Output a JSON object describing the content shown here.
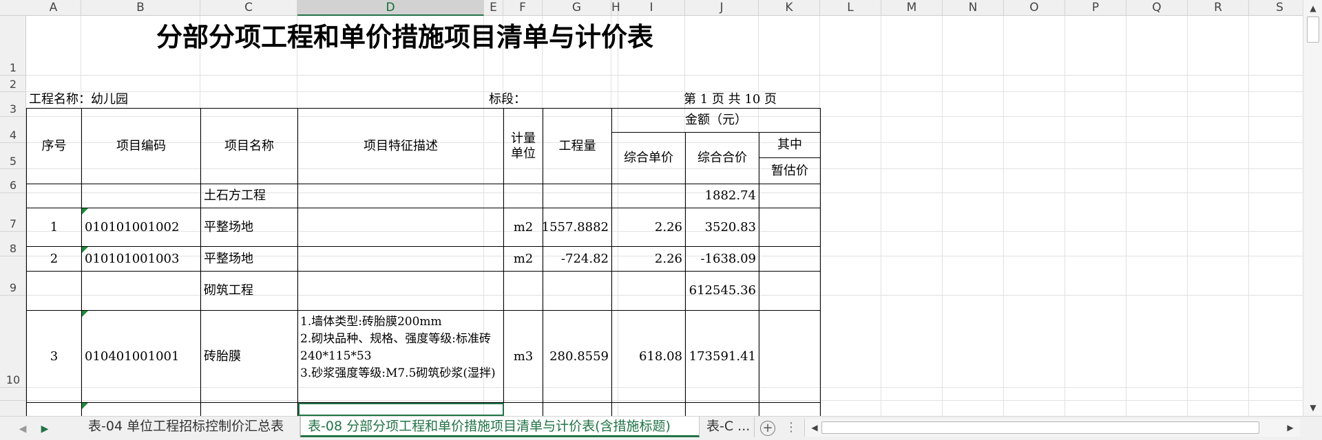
{
  "columns": [
    "A",
    "B",
    "C",
    "D",
    "E",
    "F",
    "G",
    "H",
    "I",
    "J",
    "K",
    "L",
    "M",
    "N",
    "O",
    "P",
    "Q",
    "R",
    "S"
  ],
  "active_column": "D",
  "rows": [
    "1",
    "2",
    "3",
    "4",
    "5",
    "6",
    "7",
    "8",
    "9",
    "10",
    ""
  ],
  "active_row": "",
  "sheet": {
    "title": "分部分项工程和单价措施项目清单与计价表",
    "project_name": "工程名称：幼儿园",
    "section_label": "标段：",
    "page_info": "第 1 页   共 10 页",
    "headers": {
      "seq": "序号",
      "code": "项目编码",
      "name": "项目名称",
      "desc": "项目特征描述",
      "unit": "计量单位",
      "qty": "工程量",
      "amount": "金额（元）",
      "unit_price": "综合单价",
      "total": "综合合价",
      "of_which": "其中",
      "provisional": "暂估价"
    },
    "r6": {
      "name": "土石方工程",
      "total": "1882.74"
    },
    "r7": {
      "seq": "1",
      "code": "010101001002",
      "name": "平整场地",
      "unit": "m2",
      "qty": "1557.8882",
      "price": "2.26",
      "total": "3520.83"
    },
    "r8": {
      "seq": "2",
      "code": "010101001003",
      "name": "平整场地",
      "unit": "m2",
      "qty": "-724.82",
      "price": "2.26",
      "total": "-1638.09"
    },
    "r9": {
      "name": "砌筑工程",
      "total": "612545.36"
    },
    "r10": {
      "seq": "3",
      "code": "010401001001",
      "name": "砖胎膜",
      "desc": [
        "1.墙体类型:砖胎膜200mm",
        "2.砌块品种、规格、强度等级:标准砖240*115*53",
        "3.砂浆强度等级:M7.5砌筑砂浆(湿拌)"
      ],
      "unit": "m3",
      "qty": "280.8559",
      "price": "618.08",
      "total": "173591.41"
    }
  },
  "tabs": [
    {
      "label": "表-04 单位工程招标控制价汇总表",
      "active": false
    },
    {
      "label": "表-08 分部分项工程和单价措施项目清单与计价表(含措施标题)",
      "active": true
    },
    {
      "label": "表-C ...",
      "active": false
    }
  ],
  "icons": {
    "add_sheet": "plus-circle-icon",
    "tab_options": "vertical-ellipsis-icon",
    "nav_prev": "triangle-left-icon",
    "nav_next": "triangle-right-icon"
  },
  "colors": {
    "accent": "#217346",
    "comment_marker": "#1e8b3c"
  }
}
